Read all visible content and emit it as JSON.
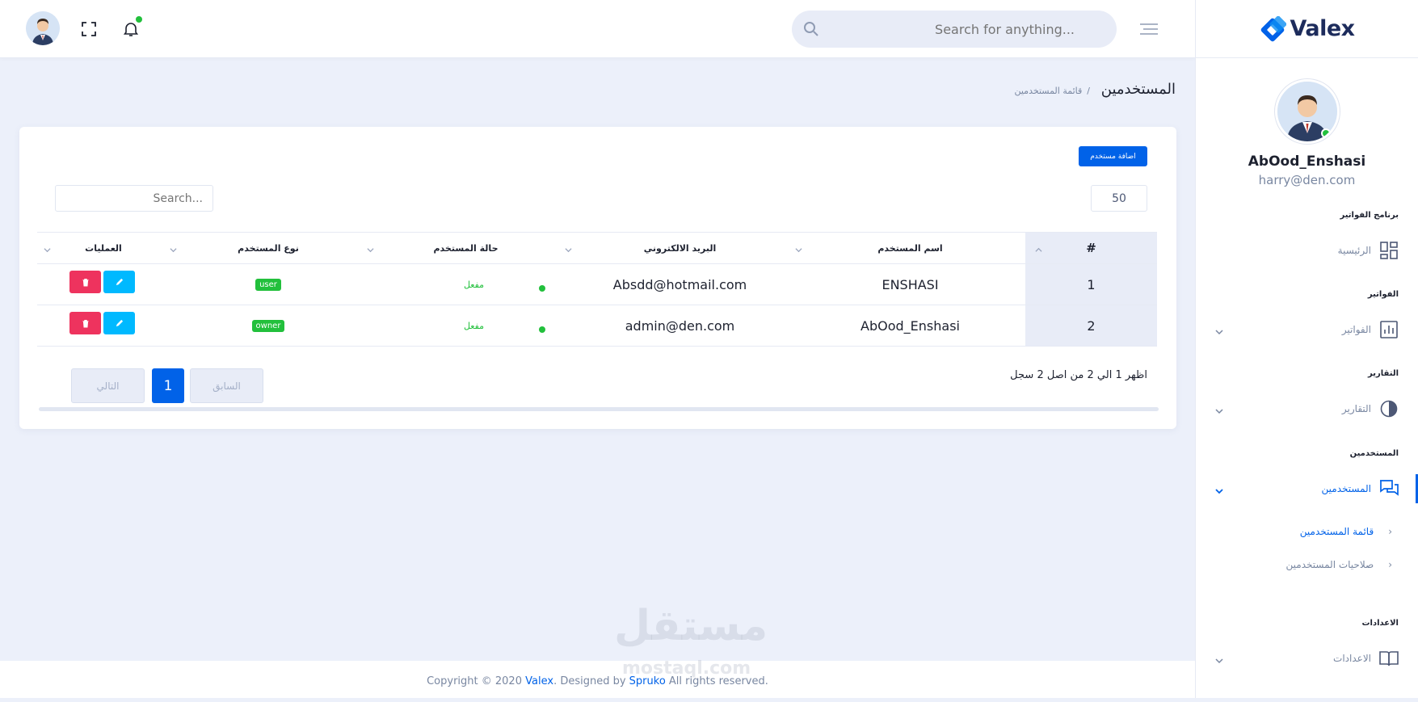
{
  "brand": {
    "name": "Valex",
    "accent": "#0162e8"
  },
  "header": {
    "search_placeholder": "Search for anything...",
    "icons": [
      "avatar",
      "fullscreen-icon",
      "bell-icon",
      "search-icon",
      "menu-icon"
    ]
  },
  "sidebar": {
    "user": {
      "name": "AbOod_Enshasi",
      "email": "harry@den.com"
    },
    "sections": [
      {
        "category": "برنامج الفواتير",
        "item": "الرئيسية",
        "icon": "dashboard-icon"
      },
      {
        "category": "الفواتير",
        "item": "الفواتير",
        "icon": "chart-icon"
      },
      {
        "category": "التقارير",
        "item": "التقارير",
        "icon": "half-circle-icon"
      },
      {
        "category": "المستخدمين",
        "item": "المستخدمين",
        "icon": "chat-icon",
        "active": true
      },
      {
        "category": "الاعدادات",
        "item": "الاعدادات",
        "icon": "book-icon"
      }
    ],
    "sub_items": [
      "قائمة المستخدمين",
      "صلاحيات المستخدمين"
    ]
  },
  "breadcrumb": {
    "title": "المستخدمين",
    "separator": "/",
    "current": "قائمة المستخدمين"
  },
  "card": {
    "add_button": "اضافة مستخدم",
    "page_length": "50",
    "search_placeholder": "Search...",
    "columns": [
      "#",
      "اسم المستخدم",
      "البريد الالكتروني",
      "حالة المستخدم",
      "نوع المستخدم",
      "العمليات"
    ],
    "rows": [
      {
        "index": "1",
        "name": "ENSHASI",
        "email": "Absdd@hotmail.com",
        "status": "مفعل",
        "type": "user"
      },
      {
        "index": "2",
        "name": "AbOod_Enshasi",
        "email": "admin@den.com",
        "status": "مفعل",
        "type": "owner"
      }
    ],
    "info": "اظهر 1 الي 2 من اصل 2 سجل",
    "pagination": {
      "prev": "السابق",
      "current": "1",
      "next": "التالي"
    }
  },
  "footer": {
    "prefix": "Copyright © 2020 ",
    "brand": "Valex",
    "middle": ". Designed by ",
    "designer": "Spruko",
    "suffix": " All rights reserved."
  },
  "watermark": {
    "text": "مستقل",
    "sub": "mostaql.com"
  },
  "colors": {
    "success": "#22c03c",
    "danger": "#ee335e",
    "info": "#00b9ff",
    "primary": "#0162e8"
  }
}
